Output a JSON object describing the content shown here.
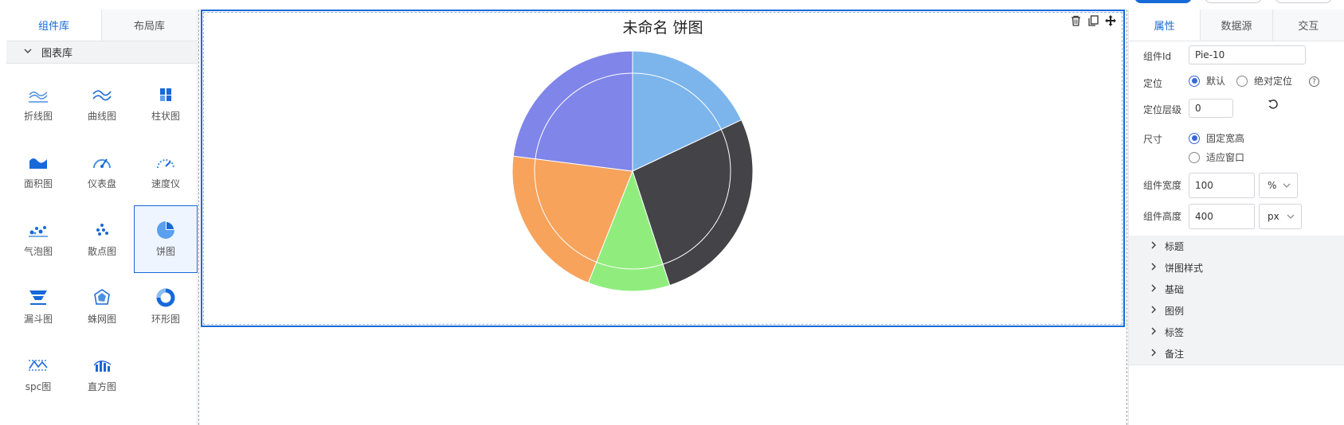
{
  "left_panel": {
    "tabs": [
      "组件库",
      "布局库"
    ],
    "group_title": "图表库",
    "items": [
      {
        "label": "折线图",
        "icon": "line-chart-icon"
      },
      {
        "label": "曲线图",
        "icon": "curve-chart-icon"
      },
      {
        "label": "柱状图",
        "icon": "bar-chart-icon"
      },
      {
        "label": "面积图",
        "icon": "area-chart-icon"
      },
      {
        "label": "仪表盘",
        "icon": "gauge-icon"
      },
      {
        "label": "速度仪",
        "icon": "speedometer-icon"
      },
      {
        "label": "气泡图",
        "icon": "bubble-chart-icon"
      },
      {
        "label": "散点图",
        "icon": "scatter-chart-icon"
      },
      {
        "label": "饼图",
        "icon": "pie-chart-icon"
      },
      {
        "label": "漏斗图",
        "icon": "funnel-chart-icon"
      },
      {
        "label": "蛛网图",
        "icon": "radar-chart-icon"
      },
      {
        "label": "环形图",
        "icon": "donut-chart-icon"
      },
      {
        "label": "spc图",
        "icon": "spc-chart-icon"
      },
      {
        "label": "直方图",
        "icon": "histogram-icon"
      }
    ],
    "selected": "饼图"
  },
  "canvas": {
    "tools": [
      "trash-icon",
      "copy-icon",
      "move-icon"
    ]
  },
  "chart_data": {
    "type": "pie",
    "title": "未命名 饼图",
    "values": [
      18,
      27,
      11,
      21,
      23
    ],
    "colors": [
      "#7cb5ec",
      "#434348",
      "#90ed7d",
      "#f7a35c",
      "#8085e9"
    ],
    "start_angle_deg": 0,
    "legend": "none"
  },
  "right_panel": {
    "tabs": [
      "属性",
      "数据源",
      "交互"
    ],
    "component_id_label": "组件Id",
    "component_id_value": "Pie-10",
    "position_label": "定位",
    "position_options": [
      "默认",
      "绝对定位"
    ],
    "position_selected": "默认",
    "help_icon": "?",
    "z_index_label": "定位层级",
    "z_index_value": "0",
    "size_label": "尺寸",
    "size_options": [
      "固定宽高",
      "适应窗口"
    ],
    "size_selected": "固定宽高",
    "width_label": "组件宽度",
    "width_value": "100",
    "width_unit": "%",
    "height_label": "组件高度",
    "height_value": "400",
    "height_unit": "px",
    "sections": [
      "标题",
      "饼图样式",
      "基础",
      "图例",
      "标签",
      "备注"
    ]
  }
}
